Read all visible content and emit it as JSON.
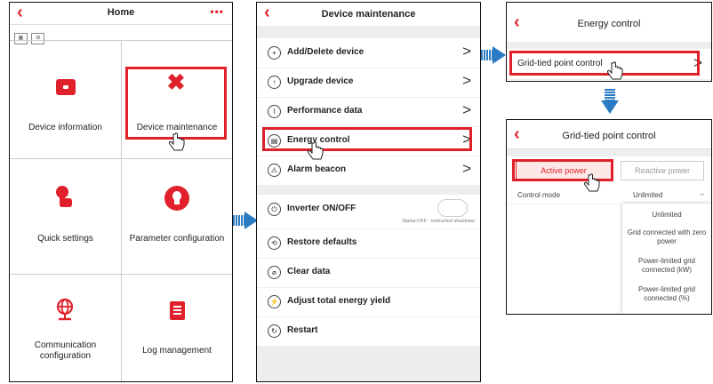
{
  "phone1": {
    "title": "Home",
    "more": "•••",
    "cells": [
      {
        "label": "Device information"
      },
      {
        "label": "Device maintenance"
      },
      {
        "label": "Quick settings"
      },
      {
        "label": "Parameter configuration"
      },
      {
        "label": "Communication configuration"
      },
      {
        "label": "Log management"
      }
    ]
  },
  "phone2": {
    "title": "Device maintenance",
    "items": [
      {
        "label": "Add/Delete device",
        "icon": "+"
      },
      {
        "label": "Upgrade device",
        "icon": "↑"
      },
      {
        "label": "Performance data",
        "icon": "⌇"
      },
      {
        "label": "Energy control",
        "icon": "▤"
      },
      {
        "label": "Alarm beacon",
        "icon": "⚠"
      }
    ],
    "items2": [
      {
        "label": "Inverter ON/OFF",
        "icon": "⏻"
      },
      {
        "label": "Restore defaults",
        "icon": "⟲"
      },
      {
        "label": "Clear data",
        "icon": "⌀"
      },
      {
        "label": "Adjust total energy yield",
        "icon": "⚡"
      },
      {
        "label": "Restart",
        "icon": "↻"
      }
    ],
    "status": "Status:OFF - instructed shutdown"
  },
  "phone3": {
    "title": "Energy control",
    "item": "Grid-tied point control"
  },
  "phone4": {
    "title": "Grid-tied point control",
    "tab_active": "Active power",
    "tab_inactive": "Reactive power",
    "control_mode_label": "Control mode",
    "control_mode_value": "Unlimited",
    "options": [
      "Unlimited",
      "Grid connected with zero power",
      "Power-limited grid connected  (kW)",
      "Power-limited grid connected  (%)"
    ]
  },
  "colors": {
    "accent": "#e0202a",
    "arrow": "#2a7bc4"
  }
}
